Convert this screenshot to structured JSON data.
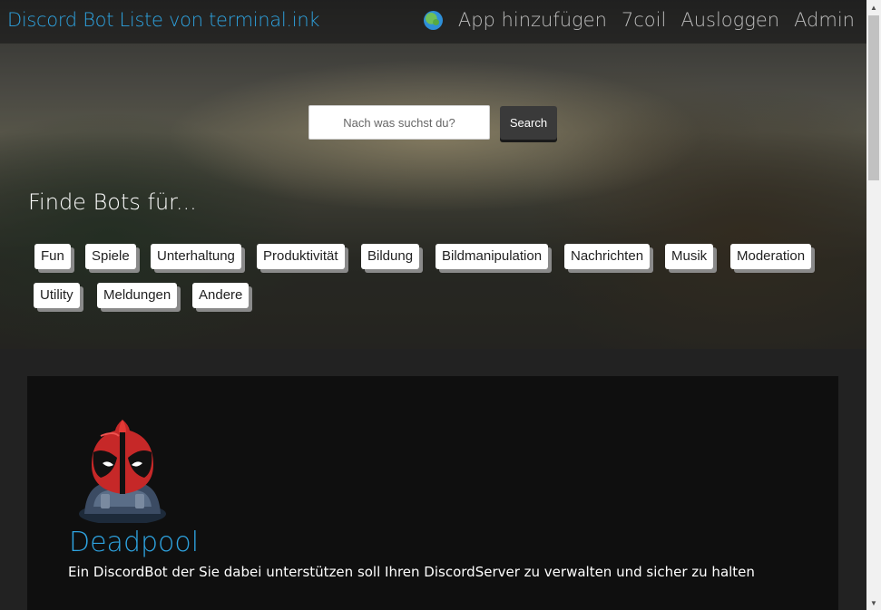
{
  "navbar": {
    "brand": "Discord Bot Liste von terminal.ink",
    "globe_icon": "globe-icon",
    "links": [
      "App hinzufügen",
      "7coil",
      "Ausloggen",
      "Admin"
    ]
  },
  "search": {
    "placeholder": "Nach was suchst du?",
    "button_label": "Search"
  },
  "categories": {
    "heading": "Finde Bots für...",
    "tags": [
      "Fun",
      "Spiele",
      "Unterhaltung",
      "Produktivität",
      "Bildung",
      "Bildmanipulation",
      "Nachrichten",
      "Musik",
      "Moderation",
      "Utility",
      "Meldungen",
      "Andere"
    ]
  },
  "featured_bot": {
    "avatar_icon": "deadpool-avatar",
    "name": "Deadpool",
    "description": "Ein DiscordBot der Sie dabei unterstützen soll Ihren DiscordServer zu verwalten und sicher zu halten"
  },
  "colors": {
    "accent": "#2ea3e0",
    "page_background": "#222222",
    "card_background": "#0f0f0f"
  }
}
